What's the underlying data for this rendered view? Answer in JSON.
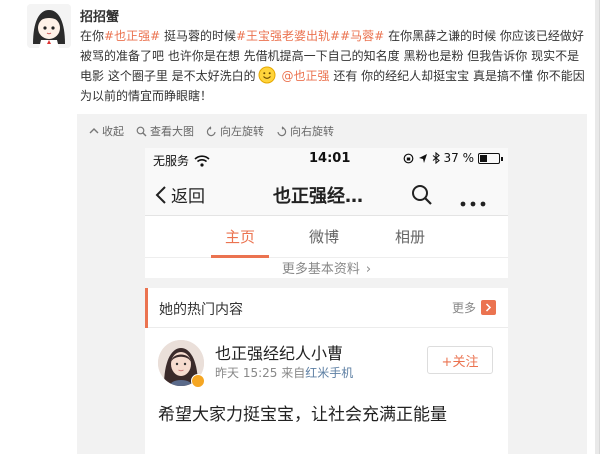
{
  "post": {
    "author": "招招蟹",
    "text": {
      "p1": "在你",
      "tag1": "#也正强#",
      "p2": "挺马蓉的时候",
      "tag2": "#王宝强老婆出轨#",
      "tag3": "#马蓉#",
      "p3": "在你黑薛之谦的时候 你应该已经做好被骂的准备了吧 也许你是在想 先借机提高一下自己的知名度 黑粉也是粉 但我告诉你 现实不是电影 这个圈子里 是不太好洗白的",
      "mention": "@也正强",
      "p4": "还有 你的经纪人却挺宝宝 真是搞不懂 你不能因为以前的情宜而睁眼瞎！"
    }
  },
  "toolbar": {
    "collapse": "收起",
    "view_large": "查看大图",
    "rotate_left": "向左旋转",
    "rotate_right": "向右旋转"
  },
  "phone": {
    "status": {
      "carrier": "无服务",
      "time": "14:01",
      "battery": "37 %",
      "battery_level": 0.37
    },
    "nav": {
      "back": "返回",
      "title": "也正强经…"
    },
    "tabs": [
      "主页",
      "微博",
      "相册"
    ],
    "more_info": "更多基本资料",
    "hot": {
      "title": "她的热门内容",
      "more": "更多",
      "poster_name": "也正强经纪人小曹",
      "meta_time": "昨天 15:25",
      "meta_from": "来自",
      "meta_source": "红米手机",
      "follow": "+关注",
      "body": "希望大家力挺宝宝，让社会充满正能量"
    }
  },
  "colors": {
    "accent": "#eb7350",
    "link": "#eb7350"
  }
}
